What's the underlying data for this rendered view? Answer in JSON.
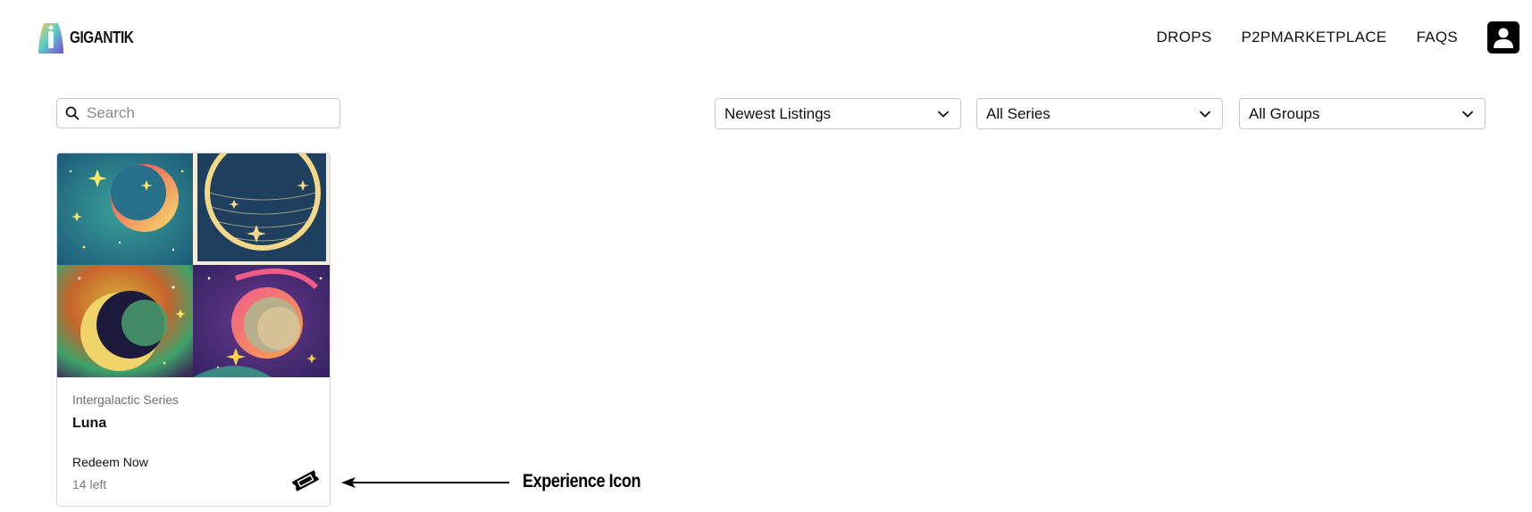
{
  "brand": {
    "name": "GIGANTIK",
    "logo_icon": "gigantik-gradient-logo-icon"
  },
  "nav": {
    "items": [
      "DROPS",
      "P2PMARKETPLACE",
      "FAQS"
    ],
    "profile_icon": "user-icon"
  },
  "filters": {
    "search": {
      "placeholder": "Search",
      "value": "",
      "icon": "search-icon"
    },
    "sort": {
      "value": "Newest Listings",
      "icon": "chevron-down-icon"
    },
    "series": {
      "value": "All Series",
      "icon": "chevron-down-icon"
    },
    "groups": {
      "value": "All Groups",
      "icon": "chevron-down-icon"
    }
  },
  "listings": [
    {
      "series": "Intergalactic Series",
      "title": "Luna",
      "status": "Redeem Now",
      "remaining": "14 left",
      "image": "four-panel crescent moon artwork",
      "badge_icon": "ticket-icon"
    }
  ],
  "annotation": {
    "label": "Experience Icon",
    "icon": "left-arrow-icon"
  }
}
